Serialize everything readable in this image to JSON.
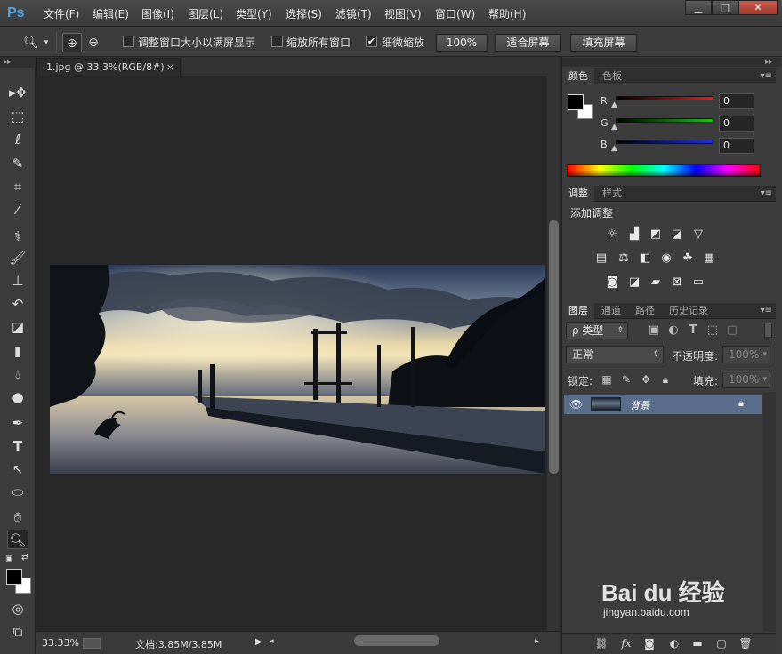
{
  "app": {
    "logo": "Ps"
  },
  "menu": [
    "文件(F)",
    "编辑(E)",
    "图像(I)",
    "图层(L)",
    "类型(Y)",
    "选择(S)",
    "滤镜(T)",
    "视图(V)",
    "窗口(W)",
    "帮助(H)"
  ],
  "window_controls": {
    "minimize": "▁",
    "restore": "□",
    "close": "✕"
  },
  "options": {
    "resize_windows_label": "调整窗口大小以满屏显示",
    "zoom_all_label": "缩放所有窗口",
    "scrubby_zoom_label": "细微缩放",
    "scrubby_zoom_checked": "✔",
    "zoom100_label": "100%",
    "fit_screen_label": "适合屏幕",
    "fill_screen_label": "填充屏幕"
  },
  "document": {
    "tab_title": "1.jpg @ 33.3%(RGB/8#)",
    "tab_close": "×"
  },
  "status": {
    "zoom": "33.33%",
    "doc_size": "文档:3.85M/3.85M"
  },
  "color_panel": {
    "tabs": [
      "颜色",
      "色板"
    ],
    "channels": [
      {
        "label": "R",
        "value": "0",
        "color": "#e02020"
      },
      {
        "label": "G",
        "value": "0",
        "color": "#20c020"
      },
      {
        "label": "B",
        "value": "0",
        "color": "#2030e0"
      }
    ]
  },
  "adjust_panel": {
    "tabs": [
      "调整",
      "样式"
    ],
    "title": "添加调整"
  },
  "layers_panel": {
    "tabs": [
      "图层",
      "通道",
      "路径",
      "历史记录"
    ],
    "filter_label": "ρ 类型",
    "blend_mode": "正常",
    "opacity_label": "不透明度:",
    "opacity_value": "100%",
    "lock_label": "锁定:",
    "fill_label": "填充:",
    "fill_value": "100%",
    "layer_name": "背景"
  },
  "watermark": {
    "text": "Bai du 经验",
    "url": "jingyan.baidu.com"
  }
}
